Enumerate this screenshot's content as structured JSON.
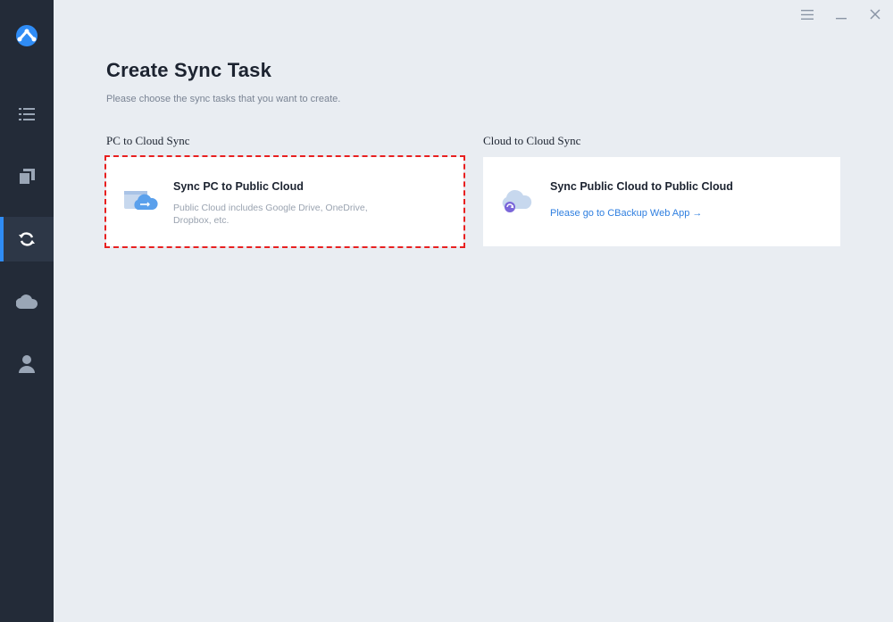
{
  "window": {
    "menu_icon": "hamburger-menu-icon",
    "minimize_icon": "minimize-icon",
    "close_icon": "close-icon"
  },
  "sidebar": {
    "logo_icon": "cbackup-logo-icon",
    "items": [
      {
        "id": "tasks",
        "icon": "list-icon",
        "active": false
      },
      {
        "id": "backup",
        "icon": "copy-icon",
        "active": false
      },
      {
        "id": "sync",
        "icon": "sync-icon",
        "active": true
      },
      {
        "id": "cloud",
        "icon": "cloud-icon",
        "active": false
      },
      {
        "id": "account",
        "icon": "user-icon",
        "active": false
      }
    ]
  },
  "page": {
    "title": "Create Sync Task",
    "subtitle": "Please choose the sync tasks that you want to create."
  },
  "sections": {
    "pc_to_cloud": {
      "label": "PC to Cloud Sync",
      "card": {
        "title": "Sync PC to Public Cloud",
        "description": "Public Cloud includes Google Drive, OneDrive, Dropbox, etc.",
        "icon": "pc-cloud-sync-icon"
      }
    },
    "cloud_to_cloud": {
      "label": "Cloud to Cloud Sync",
      "card": {
        "title": "Sync Public Cloud to Public Cloud",
        "link": "Please go to CBackup Web App",
        "link_arrow": "→",
        "icon": "cloud-cloud-sync-icon"
      }
    }
  },
  "colors": {
    "sidebar_bg": "#232b38",
    "accent": "#2f8cf5",
    "highlight_border": "#e82020",
    "main_bg": "#e9edf2"
  }
}
